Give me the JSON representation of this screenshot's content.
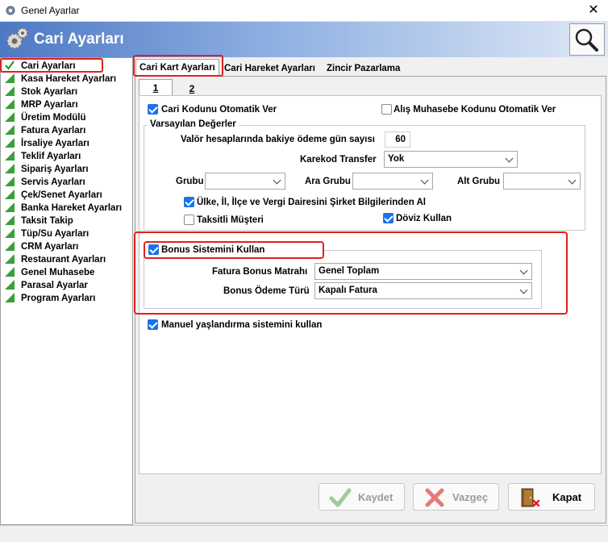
{
  "window": {
    "title": "Genel Ayarlar"
  },
  "header": {
    "title": "Cari Ayarları"
  },
  "tree": {
    "items": [
      {
        "label": "Cari Ayarları",
        "selected": true
      },
      {
        "label": "Kasa Hareket Ayarları"
      },
      {
        "label": "Stok Ayarları"
      },
      {
        "label": "MRP Ayarları"
      },
      {
        "label": "Üretim Modülü"
      },
      {
        "label": "Fatura Ayarları"
      },
      {
        "label": "İrsaliye Ayarları"
      },
      {
        "label": "Teklif Ayarları"
      },
      {
        "label": "Sipariş Ayarları"
      },
      {
        "label": "Servis Ayarları"
      },
      {
        "label": "Çek/Senet Ayarları"
      },
      {
        "label": "Banka Hareket Ayarları"
      },
      {
        "label": "Taksit Takip"
      },
      {
        "label": "Tüp/Su Ayarları"
      },
      {
        "label": "CRM Ayarları"
      },
      {
        "label": "Restaurant Ayarları"
      },
      {
        "label": "Genel Muhasebe"
      },
      {
        "label": "Parasal Ayarlar"
      },
      {
        "label": "Program Ayarları"
      }
    ]
  },
  "tabs": [
    {
      "label": "Cari Kart Ayarları",
      "active": true
    },
    {
      "label": "Cari Hareket Ayarları"
    },
    {
      "label": "Zincir Pazarlama"
    }
  ],
  "subtabs": [
    {
      "label": "1",
      "active": true
    },
    {
      "label": "2"
    }
  ],
  "form": {
    "cari_kodu_otomatik": {
      "label": "Cari Kodunu Otomatik Ver",
      "checked": true
    },
    "alis_muhasebe_kodu": {
      "label": "Alış Muhasebe Kodunu Otomatik Ver",
      "checked": false
    },
    "varsayilan": {
      "title": "Varsayılan Değerler",
      "valor_label": "Valör hesaplarında bakiye ödeme gün sayısı",
      "valor_value": "60",
      "karekod_label": "Karekod Transfer",
      "karekod_value": "Yok",
      "grubu_label": "Grubu",
      "grubu_value": "",
      "ara_grubu_label": "Ara Grubu",
      "ara_grubu_value": "",
      "alt_grubu_label": "Alt Grubu",
      "alt_grubu_value": "",
      "ulke_label": "Ülke, İl, İlçe ve Vergi Dairesini Şirket Bilgilerinden Al",
      "ulke_checked": true,
      "taksitli_label": "Taksitli Müşteri",
      "taksitli_checked": false,
      "doviz_label": "Döviz Kullan",
      "doviz_checked": true
    },
    "bonus": {
      "label": "Bonus Sistemini Kullan",
      "checked": true,
      "matrah_label": "Fatura Bonus Matrahı",
      "matrah_value": "Genel Toplam",
      "odeme_label": "Bonus Ödeme Türü",
      "odeme_value": "Kapalı Fatura"
    },
    "manuel": {
      "label": "Manuel yaşlandırma sistemini kullan",
      "checked": true
    }
  },
  "buttons": {
    "kaydet": "Kaydet",
    "vazgec": "Vazgeç",
    "kapat": "Kapat"
  },
  "colors": {
    "accent": "#1a73e8",
    "highlight": "#e02020",
    "header_start": "#4d78c4",
    "tree_icon": "#3aa03a"
  }
}
